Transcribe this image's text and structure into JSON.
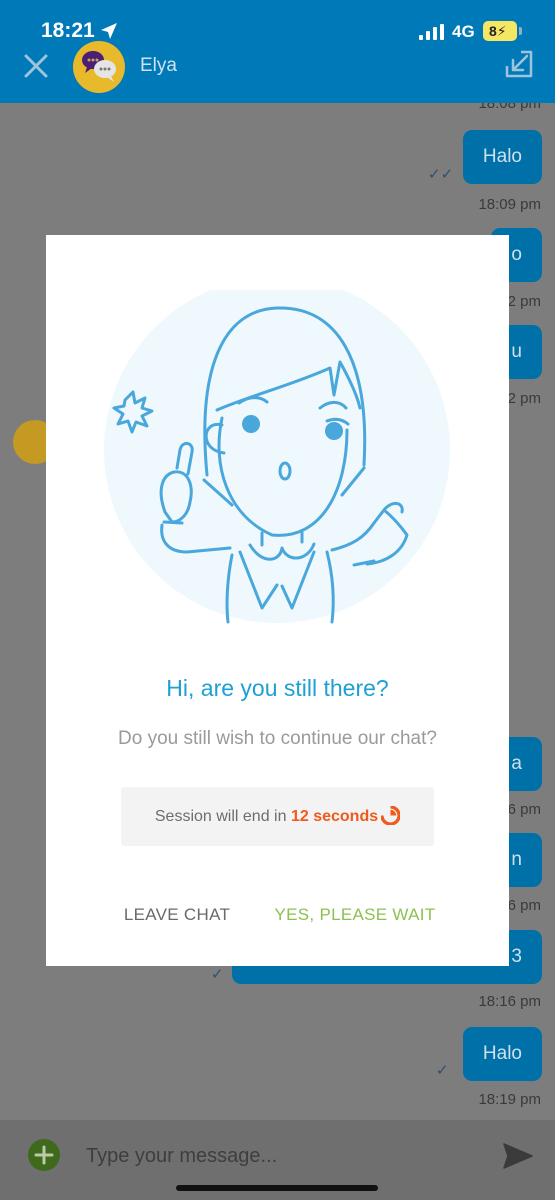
{
  "status_bar": {
    "time": "18:21",
    "network": "4G",
    "battery": "8"
  },
  "header": {
    "contact_name": "Elya"
  },
  "chat": {
    "messages": [
      {
        "time": "18:08 pm"
      },
      {
        "text": "Halo",
        "time": "18:09 pm"
      },
      {
        "text": "o",
        "time": "2 pm"
      },
      {
        "text": "u",
        "time": "2 pm"
      },
      {
        "text": "a",
        "time": "6 pm"
      },
      {
        "text": "n",
        "time": "6 pm"
      },
      {
        "text": "3",
        "time": "18:16 pm"
      },
      {
        "text": "Halo",
        "time": "18:19 pm"
      }
    ]
  },
  "input": {
    "placeholder": "Type your message..."
  },
  "modal": {
    "title": "Hi, are you still there?",
    "subtitle": "Do you still wish to continue our chat?",
    "session_prefix": "Session will end in",
    "session_seconds": "12 seconds",
    "leave_label": "LEAVE CHAT",
    "wait_label": "YES, PLEASE WAIT"
  },
  "colors": {
    "header": "#0079b8",
    "title": "#1ea0d5",
    "countdown": "#ee5b1c",
    "confirm": "#8cc152"
  },
  "icons": [
    "location-arrow-icon",
    "signal-icon",
    "battery-icon",
    "close-icon",
    "minimize-icon",
    "add-icon",
    "send-icon",
    "timer-icon"
  ]
}
